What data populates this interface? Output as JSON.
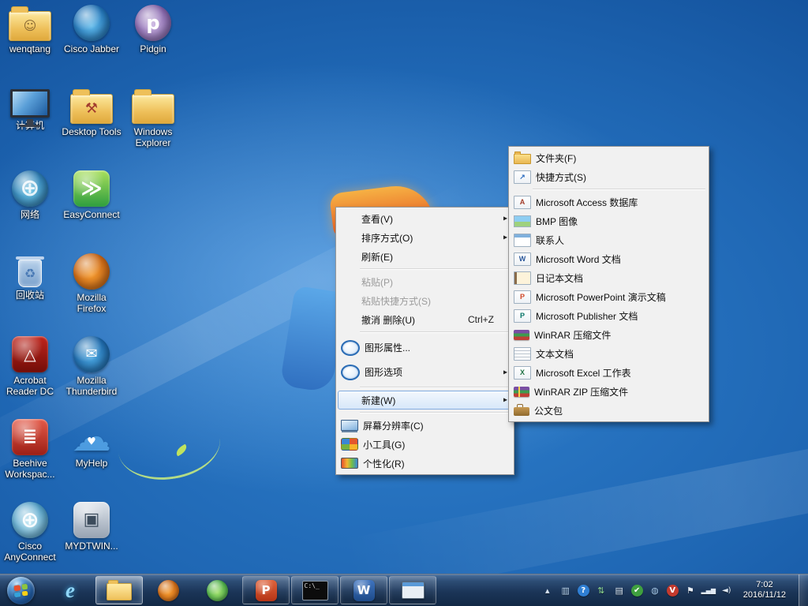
{
  "ui": {
    "submenu_arrow": "▸"
  },
  "desktop": {
    "icons": [
      {
        "id": "wenqtang",
        "label": "wenqtang",
        "col": 0,
        "row": 0,
        "kind": "folder",
        "glyph": "☺",
        "fg": "#8a6a33",
        "fs": 16
      },
      {
        "id": "cisco-jabber",
        "label": "Cisco Jabber",
        "col": 1,
        "row": 0,
        "kind": "circle",
        "c1": "#5fb9ea",
        "c2": "#0c5ca6"
      },
      {
        "id": "pidgin",
        "label": "Pidgin",
        "col": 2,
        "row": 0,
        "kind": "circle",
        "c1": "#c6aee0",
        "c2": "#6d4a96",
        "glyph": "p",
        "fg": "#ffffff",
        "fs": 24
      },
      {
        "id": "computer",
        "label": "计算机",
        "col": 0,
        "row": 1,
        "kind": "monitor"
      },
      {
        "id": "desktop-tools",
        "label": "Desktop Tools",
        "col": 1,
        "row": 1,
        "kind": "folder",
        "glyph": "⚒",
        "fg": "#a23b2e",
        "fs": 18
      },
      {
        "id": "windows-explorer",
        "label": "Windows Explorer",
        "col": 2,
        "row": 1,
        "kind": "folder"
      },
      {
        "id": "network",
        "label": "网络",
        "col": 0,
        "row": 2,
        "kind": "circle",
        "c1": "#6cc7e8",
        "c2": "#19639f",
        "glyph": "⊕",
        "fg": "rgba(255,255,255,.85)",
        "fs": 30
      },
      {
        "id": "easyconnect",
        "label": "EasyConnect",
        "col": 1,
        "row": 2,
        "kind": "square",
        "c1": "#a9e05c",
        "c2": "#2e9e3e",
        "glyph": "≫",
        "fg": "#ffffff",
        "fs": 26
      },
      {
        "id": "recycle-bin",
        "label": "回收站",
        "col": 0,
        "row": 3,
        "kind": "bin",
        "glyph": "♻",
        "fg": "#4a7ab5",
        "fs": 16
      },
      {
        "id": "firefox",
        "label": "Mozilla Firefox",
        "col": 1,
        "row": 3,
        "kind": "circle",
        "c1": "#f59a2e",
        "c2": "#b9540c"
      },
      {
        "id": "acrobat",
        "label": "Acrobat Reader DC",
        "col": 0,
        "row": 4,
        "kind": "square",
        "c1": "#c0251c",
        "c2": "#720d08",
        "glyph": "△",
        "fg": "#ffffff",
        "fs": 20
      },
      {
        "id": "thunderbird",
        "label": "Mozilla Thunderbird",
        "col": 1,
        "row": 4,
        "kind": "circle",
        "c1": "#4aa6e0",
        "c2": "#0e559a",
        "glyph": "✉",
        "fg": "#ffffff",
        "fs": 18
      },
      {
        "id": "beehive",
        "label": "Beehive Workspac...",
        "col": 0,
        "row": 5,
        "kind": "square",
        "c1": "#e55a48",
        "c2": "#9c1f16",
        "glyph": "≣",
        "fg": "#ffffff",
        "fs": 22
      },
      {
        "id": "myhelp",
        "label": "MyHelp",
        "col": 1,
        "row": 5,
        "kind": "cloud",
        "glyph": "☁"
      },
      {
        "id": "cisco-anyconnect",
        "label": "Cisco AnyConnect",
        "col": 0,
        "row": 6,
        "kind": "circle",
        "c1": "#bfe8f5",
        "c2": "#2f88b8",
        "glyph": "⊕",
        "fg": "rgba(255,255,255,.9)",
        "fs": 28
      },
      {
        "id": "mydtwin",
        "label": "MYDTWIN...",
        "col": 1,
        "row": 6,
        "kind": "square",
        "c1": "#dfe5ec",
        "c2": "#97a3b2",
        "glyph": "▣",
        "fg": "#3c4c5c",
        "fs": 22
      }
    ]
  },
  "context_menu": {
    "items": [
      {
        "id": "view",
        "label": "查看(V)",
        "submenu": true
      },
      {
        "id": "sort-by",
        "label": "排序方式(O)",
        "submenu": true
      },
      {
        "id": "refresh",
        "label": "刷新(E)"
      },
      {
        "type": "sep"
      },
      {
        "id": "paste",
        "label": "粘贴(P)",
        "disabled": true
      },
      {
        "id": "paste-shortcut",
        "label": "粘贴快捷方式(S)",
        "disabled": true
      },
      {
        "id": "undo-delete",
        "label": "撤消 删除(U)",
        "shortcut": "Ctrl+Z"
      },
      {
        "type": "sep"
      },
      {
        "id": "graphics-properties",
        "label": "图形属性...",
        "icon": "intel",
        "tall": true
      },
      {
        "id": "graphics-options",
        "label": "图形选项",
        "icon": "intel",
        "tall": true,
        "submenu": true
      },
      {
        "type": "sep"
      },
      {
        "id": "new",
        "label": "新建(W)",
        "submenu": true,
        "highlighted": true
      },
      {
        "type": "sep"
      },
      {
        "id": "screen-resolution",
        "label": "屏幕分辨率(C)",
        "icon": "display"
      },
      {
        "id": "gadgets",
        "label": "小工具(G)",
        "icon": "gadget"
      },
      {
        "id": "personalize",
        "label": "个性化(R)",
        "icon": "personalize"
      }
    ]
  },
  "new_submenu": {
    "items": [
      {
        "id": "folder",
        "label": "文件夹(F)",
        "icon": "folder"
      },
      {
        "id": "shortcut",
        "label": "快捷方式(S)",
        "icon": "shortcut",
        "badge": "↗",
        "badge_color": "#2f6fc0"
      },
      {
        "type": "sep"
      },
      {
        "id": "access",
        "label": "Microsoft Access 数据库",
        "icon": "access",
        "badge": "A",
        "badge_color": "#a33e2c"
      },
      {
        "id": "bmp",
        "label": "BMP 图像",
        "icon": "bmp"
      },
      {
        "id": "contact",
        "label": "联系人",
        "icon": "contact"
      },
      {
        "id": "word",
        "label": "Microsoft Word 文档",
        "icon": "word",
        "badge": "W",
        "badge_color": "#2b579a"
      },
      {
        "id": "journal",
        "label": "日记本文档",
        "icon": "journal"
      },
      {
        "id": "powerpoint",
        "label": "Microsoft PowerPoint 演示文稿",
        "icon": "ppt",
        "badge": "P",
        "badge_color": "#d04727"
      },
      {
        "id": "publisher",
        "label": "Microsoft Publisher 文档",
        "icon": "publisher",
        "badge": "P",
        "badge_color": "#077568"
      },
      {
        "id": "winrar",
        "label": "WinRAR 压缩文件",
        "icon": "rar"
      },
      {
        "id": "text",
        "label": "文本文档",
        "icon": "txt"
      },
      {
        "id": "excel",
        "label": "Microsoft Excel 工作表",
        "icon": "excel",
        "badge": "X",
        "badge_color": "#217346"
      },
      {
        "id": "winrar-zip",
        "label": "WinRAR ZIP 压缩文件",
        "icon": "zip"
      },
      {
        "id": "briefcase",
        "label": "公文包",
        "icon": "briefcase"
      }
    ]
  },
  "taskbar": {
    "start": {
      "flag_colors": [
        "#e8502e",
        "#8dc63f",
        "#35a2da",
        "#fbd116"
      ]
    },
    "buttons": [
      {
        "id": "internet-explorer",
        "kind": "ie",
        "glyph": "e",
        "state": "pinned"
      },
      {
        "id": "explorer",
        "kind": "folder",
        "state": "active"
      },
      {
        "id": "firefox",
        "kind": "circle",
        "c1": "#f59a2e",
        "c2": "#b9540c",
        "state": "pinned"
      },
      {
        "id": "green-browser",
        "kind": "circle",
        "c1": "#9fe06a",
        "c2": "#2e9a3c",
        "state": "pinned"
      },
      {
        "id": "powerpoint",
        "kind": "square",
        "glyph": "P",
        "c1": "#e0643c",
        "c2": "#b53416",
        "state": "running"
      },
      {
        "id": "cmd",
        "kind": "cmd",
        "glyph": "C:\\_",
        "state": "running"
      },
      {
        "id": "word",
        "kind": "square",
        "glyph": "W",
        "c1": "#3f74c0",
        "c2": "#1d4a88",
        "state": "running"
      },
      {
        "id": "window-app",
        "kind": "window",
        "state": "running"
      }
    ],
    "tray": [
      {
        "id": "hidden-icons",
        "glyph": "▴",
        "color": "#d6e2ef"
      },
      {
        "id": "graphics",
        "glyph": "▥",
        "color": "#bcd7ef"
      },
      {
        "id": "help",
        "glyph": "?",
        "color": "#ffffff",
        "bg": "#2f7fd4"
      },
      {
        "id": "sync",
        "glyph": "⇅",
        "color": "#8fd98f"
      },
      {
        "id": "display",
        "glyph": "▤",
        "color": "#d9e6f2"
      },
      {
        "id": "safety",
        "glyph": "✔",
        "color": "#ffffff",
        "bg": "#3fa03f"
      },
      {
        "id": "network",
        "glyph": "◍",
        "color": "#a9cef0"
      },
      {
        "id": "mcafee",
        "glyph": "V",
        "color": "#ffffff",
        "bg": "#c43a2e"
      },
      {
        "id": "input-flag",
        "glyph": "⚑",
        "color": "#e8eef5"
      },
      {
        "id": "signal",
        "glyph": "▂▄▆",
        "color": "#dfe9f4",
        "fs": 8
      },
      {
        "id": "volume",
        "glyph": "◄)",
        "color": "#dfe9f4",
        "fs": 10
      }
    ],
    "clock": {
      "time": "7:02",
      "date": "2016/11/12"
    }
  }
}
